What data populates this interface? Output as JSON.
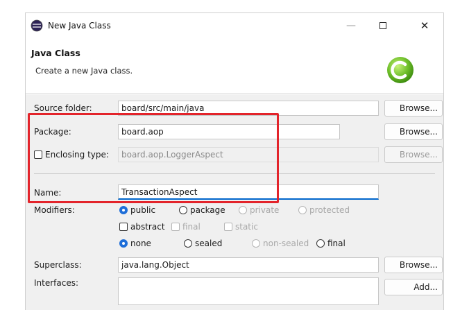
{
  "window": {
    "title": "New Java Class",
    "close_glyph": "✕",
    "min_glyph": "—"
  },
  "banner": {
    "title": "Java Class",
    "subtitle": "Create a new Java class."
  },
  "form": {
    "source_folder": {
      "label": "Source folder:",
      "value": "board/src/main/java",
      "button": "Browse..."
    },
    "package": {
      "label": "Package:",
      "value": "board.aop",
      "button": "Browse..."
    },
    "enclosing_type": {
      "label": "Enclosing type:",
      "value": "board.aop.LoggerAspect",
      "button": "Browse...",
      "checked": false
    },
    "name": {
      "label": "Name:",
      "value": "TransactionAspect"
    },
    "modifiers": {
      "label": "Modifiers:",
      "access": [
        "public",
        "package",
        "private",
        "protected"
      ],
      "access_selected": "public",
      "flags": [
        "abstract",
        "final",
        "static"
      ],
      "kind": [
        "none",
        "sealed",
        "non-sealed",
        "final"
      ],
      "kind_selected": "none"
    },
    "superclass": {
      "label": "Superclass:",
      "value": "java.lang.Object",
      "button": "Browse..."
    },
    "interfaces": {
      "label": "Interfaces:",
      "button": "Add..."
    }
  },
  "colors": {
    "accent": "#1e6ed8",
    "highlight": "#e3242b"
  }
}
